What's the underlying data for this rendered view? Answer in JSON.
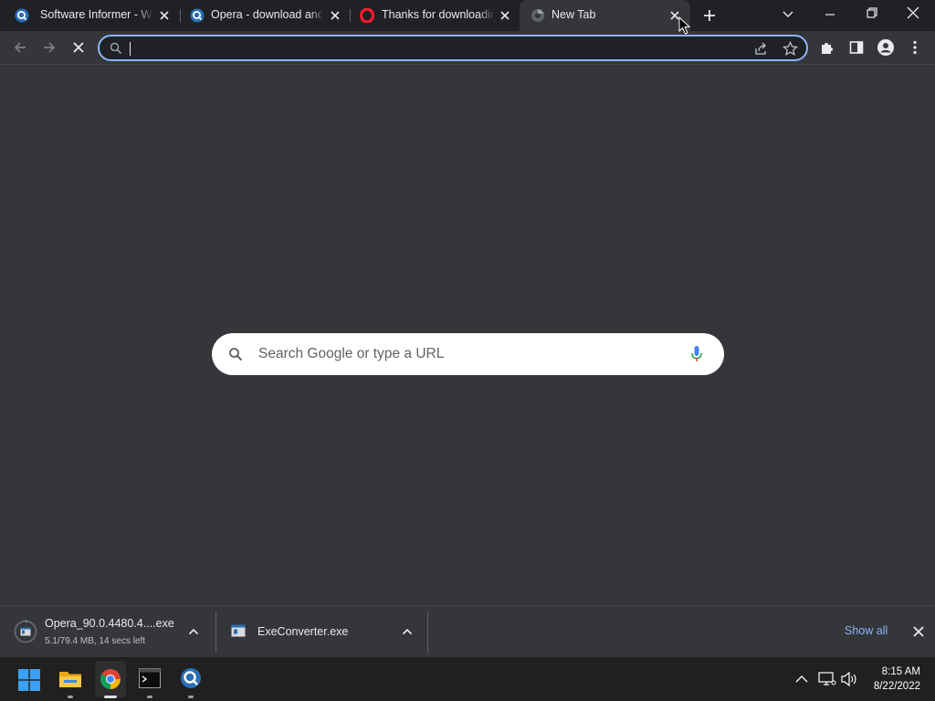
{
  "tabs": [
    {
      "title": "Software Informer - Wi",
      "icon": "software-informer-icon"
    },
    {
      "title": "Opera - download and",
      "icon": "software-informer-icon"
    },
    {
      "title": "Thanks for downloadin",
      "icon": "opera-icon"
    },
    {
      "title": "New Tab",
      "icon": "chrome-newtab-icon"
    }
  ],
  "omnibox": {
    "value": "",
    "placeholder": ""
  },
  "ntp": {
    "search_placeholder": "Search Google or type a URL"
  },
  "downloads": [
    {
      "name": "Opera_90.0.4480.4....exe",
      "status": "5.1/79.4 MB, 14 secs left"
    },
    {
      "name": "ExeConverter.exe",
      "status": ""
    }
  ],
  "shelf": {
    "show_all": "Show all"
  },
  "clock": {
    "time": "8:15 AM",
    "date": "8/22/2022"
  },
  "colors": {
    "accent": "#8ab4f8",
    "link": "#8ab4f8",
    "ntp_bg": "#35363a"
  }
}
